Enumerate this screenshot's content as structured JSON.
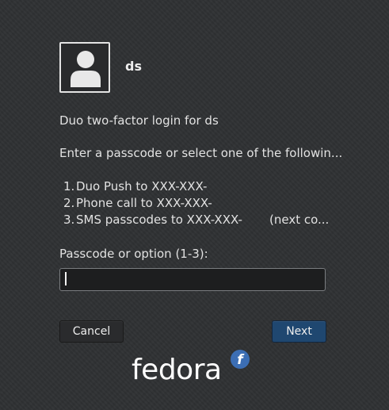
{
  "user": {
    "name": "ds"
  },
  "prompt": {
    "title": "Duo two-factor login for ds",
    "instruction": "Enter a passcode or select one of the followin...",
    "options": [
      {
        "num": "1.",
        "text": "Duo Push to XXX-XXX-",
        "extra": ""
      },
      {
        "num": "2.",
        "text": "Phone call to XXX-XXX-",
        "extra": ""
      },
      {
        "num": "3.",
        "text": "SMS passcodes to XXX-XXX-",
        "extra": "(next co..."
      }
    ],
    "field_label": "Passcode or option (1-3):",
    "field_value": ""
  },
  "buttons": {
    "cancel": "Cancel",
    "next": "Next"
  },
  "branding": {
    "logo_text": "fedora",
    "logo_glyph": "f"
  },
  "colors": {
    "background": "#2f3133",
    "accent_button": "#1f4770",
    "fedora_blue": "#3c6eb4"
  }
}
